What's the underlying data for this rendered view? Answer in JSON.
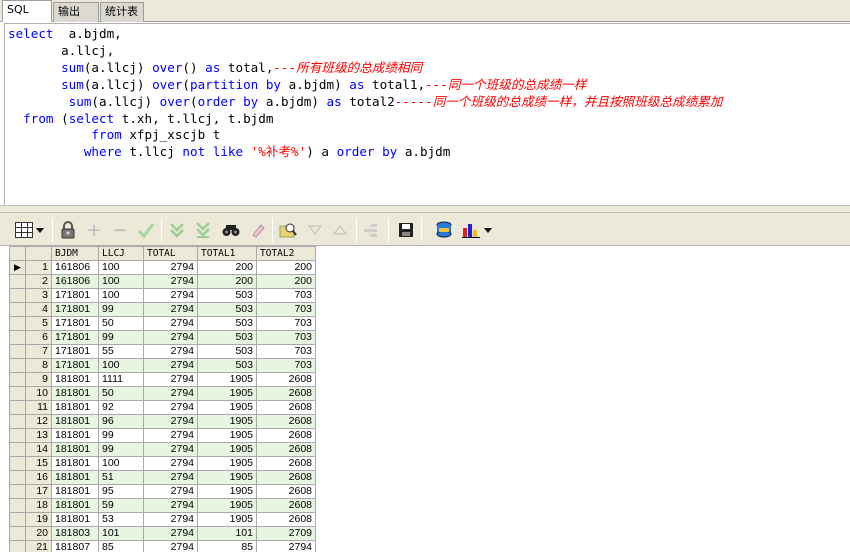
{
  "tabs": [
    "SQL",
    "输出",
    "统计表"
  ],
  "sql": {
    "line1": [
      "select",
      "  a.bjdm,"
    ],
    "line2": "       a.llcj,",
    "line3": {
      "indent": "       ",
      "fn": "sum",
      "a": "(a.llcj) ",
      "over": "over",
      "b": "() ",
      "as": "as",
      "alias": " total,",
      "comment": "---所有班级的总成绩相同"
    },
    "line4": {
      "indent": "       ",
      "fn": "sum",
      "a": "(a.llcj) ",
      "over": "over",
      "b": "(",
      "partition": "partition by",
      "c": " a.bjdm) ",
      "as": "as",
      "alias": " total1,",
      "comment": "---同一个班级的总成绩一样"
    },
    "line5": {
      "indent": "        ",
      "fn": "sum",
      "a": "(a.llcj) ",
      "over": "over",
      "b": "(",
      "order": "order by",
      "c": " a.bjdm) ",
      "as": "as",
      "alias": " total2",
      "comment": "-----同一个班级的总成绩一样，并且按照班级总成绩累加"
    },
    "line6": {
      "indent": "  ",
      "from": "from",
      "a": " (",
      "select": "select",
      "b": " t.xh, t.llcj, t.bjdm"
    },
    "line7": {
      "indent": "           ",
      "from": "from",
      "b": " xfpj_xscjb t"
    },
    "line8": {
      "indent": "          ",
      "where": "where",
      "a": " t.llcj ",
      "not": "not",
      "sp": " ",
      "like": "like",
      "sp2": " ",
      "str": "'%补考%'",
      "b": ") a ",
      "order": "order by",
      "c": " a.bjdm"
    }
  },
  "grid": {
    "columns": [
      "BJDM",
      "LLCJ",
      "TOTAL",
      "TOTAL1",
      "TOTAL2"
    ],
    "rows": [
      [
        "1",
        "161806",
        "100",
        "2794",
        "200",
        "200"
      ],
      [
        "2",
        "161806",
        "100",
        "2794",
        "200",
        "200"
      ],
      [
        "3",
        "171801",
        "100",
        "2794",
        "503",
        "703"
      ],
      [
        "4",
        "171801",
        "99",
        "2794",
        "503",
        "703"
      ],
      [
        "5",
        "171801",
        "50",
        "2794",
        "503",
        "703"
      ],
      [
        "6",
        "171801",
        "99",
        "2794",
        "503",
        "703"
      ],
      [
        "7",
        "171801",
        "55",
        "2794",
        "503",
        "703"
      ],
      [
        "8",
        "171801",
        "100",
        "2794",
        "503",
        "703"
      ],
      [
        "9",
        "181801",
        "1111",
        "2794",
        "1905",
        "2608"
      ],
      [
        "10",
        "181801",
        "50",
        "2794",
        "1905",
        "2608"
      ],
      [
        "11",
        "181801",
        "92",
        "2794",
        "1905",
        "2608"
      ],
      [
        "12",
        "181801",
        "96",
        "2794",
        "1905",
        "2608"
      ],
      [
        "13",
        "181801",
        "99",
        "2794",
        "1905",
        "2608"
      ],
      [
        "14",
        "181801",
        "99",
        "2794",
        "1905",
        "2608"
      ],
      [
        "15",
        "181801",
        "100",
        "2794",
        "1905",
        "2608"
      ],
      [
        "16",
        "181801",
        "51",
        "2794",
        "1905",
        "2608"
      ],
      [
        "17",
        "181801",
        "95",
        "2794",
        "1905",
        "2608"
      ],
      [
        "18",
        "181801",
        "59",
        "2794",
        "1905",
        "2608"
      ],
      [
        "19",
        "181801",
        "53",
        "2794",
        "1905",
        "2608"
      ],
      [
        "20",
        "181803",
        "101",
        "2794",
        "101",
        "2709"
      ],
      [
        "21",
        "181807",
        "85",
        "2794",
        "85",
        "2794"
      ]
    ],
    "current_row_marker": "▶"
  },
  "toolbar_icons": [
    "grid-view-icon",
    "dropdown-arrow-icon",
    "lock-icon",
    "add-record-icon",
    "delete-record-icon",
    "post-record-icon",
    "fetch-next-icon",
    "fetch-last-icon",
    "find-icon",
    "clear-icon",
    "query-by-example-icon",
    "sort-descending-icon",
    "sort-ascending-icon",
    "filter-icon",
    "save-icon",
    "export-icon",
    "chart-icon",
    "chart-dropdown-icon"
  ]
}
